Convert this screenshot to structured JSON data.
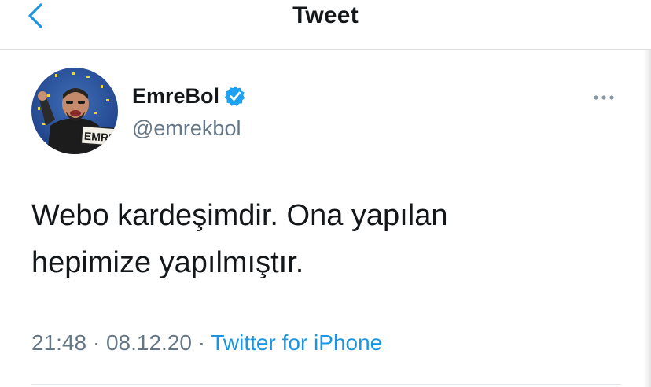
{
  "header": {
    "title": "Tweet",
    "back_icon": "chevron-left-icon"
  },
  "author": {
    "display_name": "EmreBol",
    "handle": "@emrekbol",
    "verified": true,
    "avatar_text": "EMRE"
  },
  "tweet": {
    "lines": [
      "Webo kardeşimdir. Ona yapılan",
      "hepimize yapılmıştır."
    ],
    "time": "21:48",
    "date": "08.12.20",
    "separator": "·",
    "source": "Twitter for iPhone"
  },
  "colors": {
    "accent": "#1b95e0",
    "text": "#14171a",
    "secondary": "#657786",
    "verified": "#1da1f2"
  }
}
